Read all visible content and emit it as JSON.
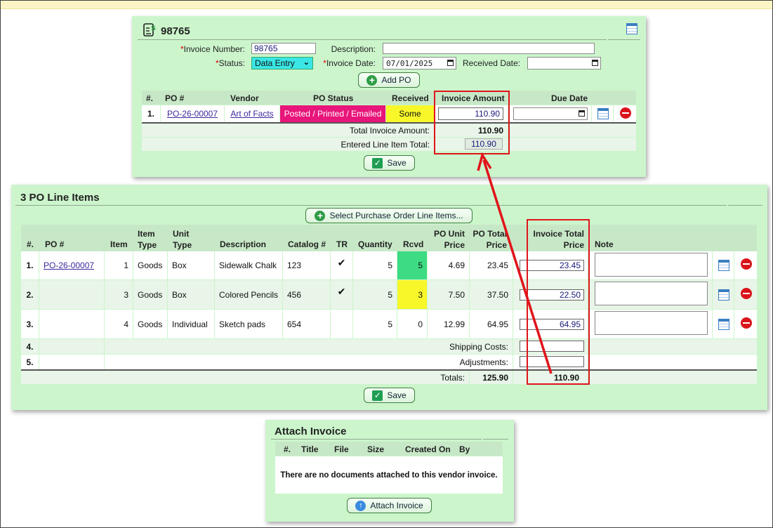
{
  "invoice_panel": {
    "title": "98765",
    "fields": {
      "invoice_number_label": "Invoice Number:",
      "invoice_number_value": "98765",
      "description_label": "Description:",
      "description_value": "",
      "status_label": "Status:",
      "status_value": "Data Entry",
      "invoice_date_label": "Invoice Date:",
      "invoice_date_value": "07/01/2025",
      "received_date_label": "Received Date:",
      "received_date_value": "",
      "required_mark": "*"
    },
    "add_po_button": "Add PO",
    "po_table": {
      "headers": [
        "#.",
        "PO #",
        "Vendor",
        "PO Status",
        "Received",
        "Invoice Amount",
        "Due Date"
      ],
      "rows": [
        {
          "num": "1.",
          "po": "PO-26-00007",
          "vendor": "Art of Facts",
          "status": "Posted / Printed / Emailed",
          "received": "Some",
          "amount": "110.90",
          "due": ""
        }
      ],
      "total_label": "Total Invoice Amount:",
      "total_value": "110.90",
      "entered_label": "Entered Line Item Total:",
      "entered_value": "110.90"
    },
    "save_button": "Save"
  },
  "lines_panel": {
    "title": "3 PO Line Items",
    "select_button": "Select Purchase Order Line Items...",
    "headers": {
      "num": "#.",
      "po": "PO #",
      "item": "Item",
      "item_type_1": "Item",
      "item_type_2": "Type",
      "unit_type_1": "Unit",
      "unit_type_2": "Type",
      "description": "Description",
      "catalog": "Catalog #",
      "tr": "TR",
      "quantity": "Quantity",
      "rcvd": "Rcvd",
      "po_unit_1": "PO Unit",
      "po_unit_2": "Price",
      "po_total_1": "PO Total",
      "po_total_2": "Price",
      "inv_total_1": "Invoice Total",
      "inv_total_2": "Price",
      "note": "Note"
    },
    "rows": [
      {
        "num": "1.",
        "po": "PO-26-00007",
        "item": "1",
        "item_type": "Goods",
        "unit_type": "Box",
        "description": "Sidewalk Chalk",
        "catalog": "123",
        "tr": "✔",
        "quantity": "5",
        "rcvd": "5",
        "rcvd_color": "#3ddc84",
        "unit_price": "4.69",
        "po_total": "23.45",
        "inv_total": "23.45"
      },
      {
        "num": "2.",
        "po": "",
        "item": "3",
        "item_type": "Goods",
        "unit_type": "Box",
        "description": "Colored Pencils",
        "catalog": "456",
        "tr": "✔",
        "quantity": "5",
        "rcvd": "3",
        "rcvd_color": "#f7f72a",
        "unit_price": "7.50",
        "po_total": "37.50",
        "inv_total": "22.50"
      },
      {
        "num": "3.",
        "po": "",
        "item": "4",
        "item_type": "Goods",
        "unit_type": "Individual",
        "description": "Sketch pads",
        "catalog": "654",
        "tr": "",
        "quantity": "5",
        "rcvd": "0",
        "rcvd_color": "#ffffff",
        "unit_price": "12.99",
        "po_total": "64.95",
        "inv_total": "64.95"
      }
    ],
    "row4": {
      "num": "4.",
      "label": "Shipping Costs:",
      "value": ""
    },
    "row5": {
      "num": "5.",
      "label": "Adjustments:",
      "value": ""
    },
    "totals": {
      "label": "Totals:",
      "po_total": "125.90",
      "inv_total": "110.90"
    },
    "save_button": "Save"
  },
  "attach_panel": {
    "title": "Attach Invoice",
    "headers": [
      "#.",
      "Title",
      "File",
      "Size",
      "Created On",
      "By"
    ],
    "empty_message": "There are no documents attached to this vendor invoice.",
    "attach_button": "Attach Invoice"
  },
  "colors": {
    "panel_bg": "#ccf5cc",
    "status_pink": "#e8157a",
    "received_yellow": "#f7f72a",
    "highlight_red": "#e0141a"
  }
}
